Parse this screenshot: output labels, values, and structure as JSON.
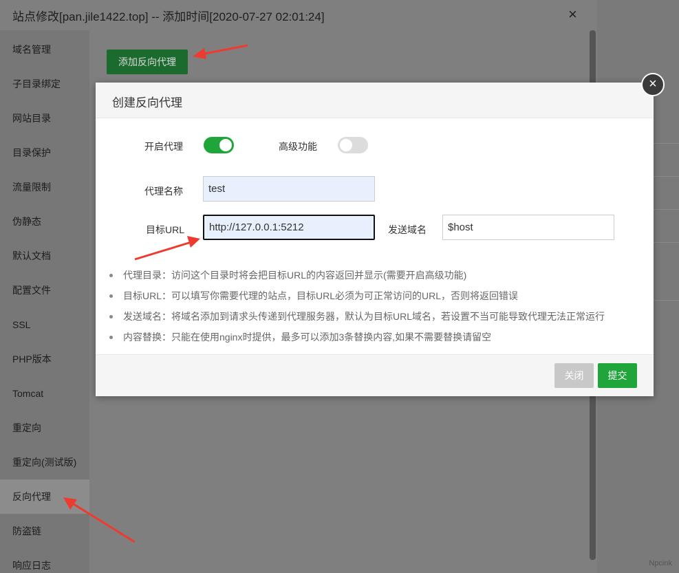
{
  "window": {
    "title": "站点修改[pan.jile1422.top] -- 添加时间[2020-07-27 02:01:24]",
    "close_icon": "×"
  },
  "sidebar": {
    "items": [
      {
        "label": "域名管理"
      },
      {
        "label": "子目录绑定"
      },
      {
        "label": "网站目录"
      },
      {
        "label": "目录保护"
      },
      {
        "label": "流量限制"
      },
      {
        "label": "伪静态"
      },
      {
        "label": "默认文档"
      },
      {
        "label": "配置文件"
      },
      {
        "label": "SSL"
      },
      {
        "label": "PHP版本"
      },
      {
        "label": "Tomcat"
      },
      {
        "label": "重定向"
      },
      {
        "label": "重定向(测试版)"
      },
      {
        "label": "反向代理"
      },
      {
        "label": "防盗链"
      },
      {
        "label": "响应日志"
      }
    ],
    "active": "反向代理"
  },
  "content": {
    "add_button": "添加反向代理"
  },
  "modal": {
    "title": "创建反向代理",
    "close_icon": "×",
    "enable_proxy": {
      "label": "开启代理",
      "on": true
    },
    "advanced": {
      "label": "高级功能",
      "on": false
    },
    "proxy_name": {
      "label": "代理名称",
      "value": "test"
    },
    "target_url": {
      "label": "目标URL",
      "value": "http://127.0.0.1:5212"
    },
    "send_domain": {
      "label": "发送域名",
      "value": "$host"
    },
    "notes": [
      "代理目录：访问这个目录时将会把目标URL的内容返回并显示(需要开启高级功能)",
      "目标URL：可以填写你需要代理的站点，目标URL必须为可正常访问的URL，否则将返回错误",
      "发送域名：将域名添加到请求头传递到代理服务器，默认为目标URL域名，若设置不当可能导致代理无法正常运行",
      "内容替换：只能在使用nginx时提供，最多可以添加3条替换内容,如果不需要替换请留空"
    ],
    "close_button": "关闭",
    "submit_button": "提交"
  },
  "watermark": "Npcink",
  "colors": {
    "accent": "#20a53a",
    "arrow": "#ee3b2f"
  }
}
